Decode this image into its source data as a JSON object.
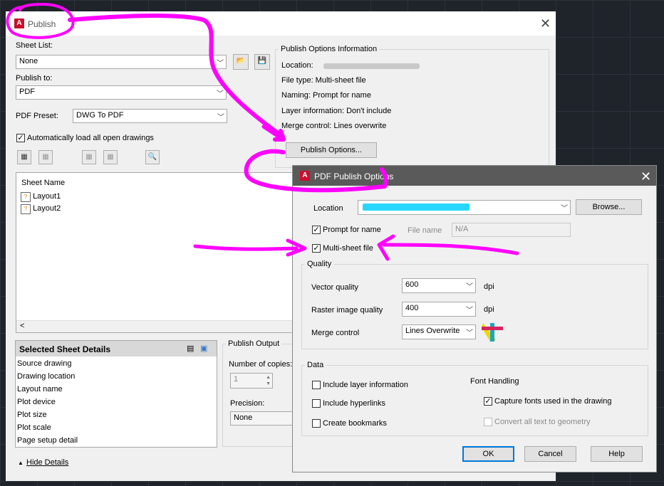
{
  "publish": {
    "title": "Publish",
    "sheet_list_label": "Sheet List:",
    "sheet_list_value": "None",
    "publish_to_label": "Publish to:",
    "publish_to_value": "PDF",
    "pdf_preset_label": "PDF Preset:",
    "pdf_preset_value": "DWG To PDF",
    "auto_load_label": "Automatically load all open drawings",
    "auto_load_checked": true,
    "sheet_name_header": "Sheet Name",
    "sheets": [
      "Layout1",
      "Layout2"
    ],
    "options_info": {
      "title": "Publish Options Information",
      "location": "Location:",
      "file_type": "File type: Multi-sheet file",
      "naming": "Naming: Prompt for name",
      "layer_info": "Layer information: Don't include",
      "merge_control": "Merge control: Lines overwrite",
      "button": "Publish Options..."
    },
    "selected_details": {
      "title": "Selected Sheet Details",
      "rows": [
        "Source drawing",
        "Drawing location",
        "Layout name",
        "Plot device",
        "Plot size",
        "Plot scale",
        "Page setup detail"
      ]
    },
    "output": {
      "title": "Publish Output",
      "copies_label": "Number of copies:",
      "copies_value": "1",
      "precision_label": "Precision:",
      "precision_value": "None"
    },
    "hide_details": "Hide Details",
    "scroll_left": "<"
  },
  "pdf_options": {
    "title": "PDF Publish Options",
    "location_label": "Location",
    "browse_label": "Browse...",
    "prompt_for_name_label": "Prompt for name",
    "file_name_label": "File name",
    "file_name_value": "N/A",
    "multi_sheet_label": "Multi-sheet file",
    "quality_title": "Quality",
    "vector_quality_label": "Vector quality",
    "vector_quality_value": "600",
    "raster_quality_label": "Raster image quality",
    "raster_quality_value": "400",
    "dpi": "dpi",
    "merge_control_label": "Merge control",
    "merge_control_value": "Lines Overwrite",
    "data_title": "Data",
    "include_layer_label": "Include layer information",
    "include_hyperlinks_label": "Include hyperlinks",
    "create_bookmarks_label": "Create bookmarks",
    "font_handling_title": "Font Handling",
    "capture_fonts_label": "Capture fonts used in the drawing",
    "convert_text_label": "Convert all text to geometry",
    "ok": "OK",
    "cancel": "Cancel",
    "help": "Help"
  },
  "annotation_color": "#ff00ff"
}
